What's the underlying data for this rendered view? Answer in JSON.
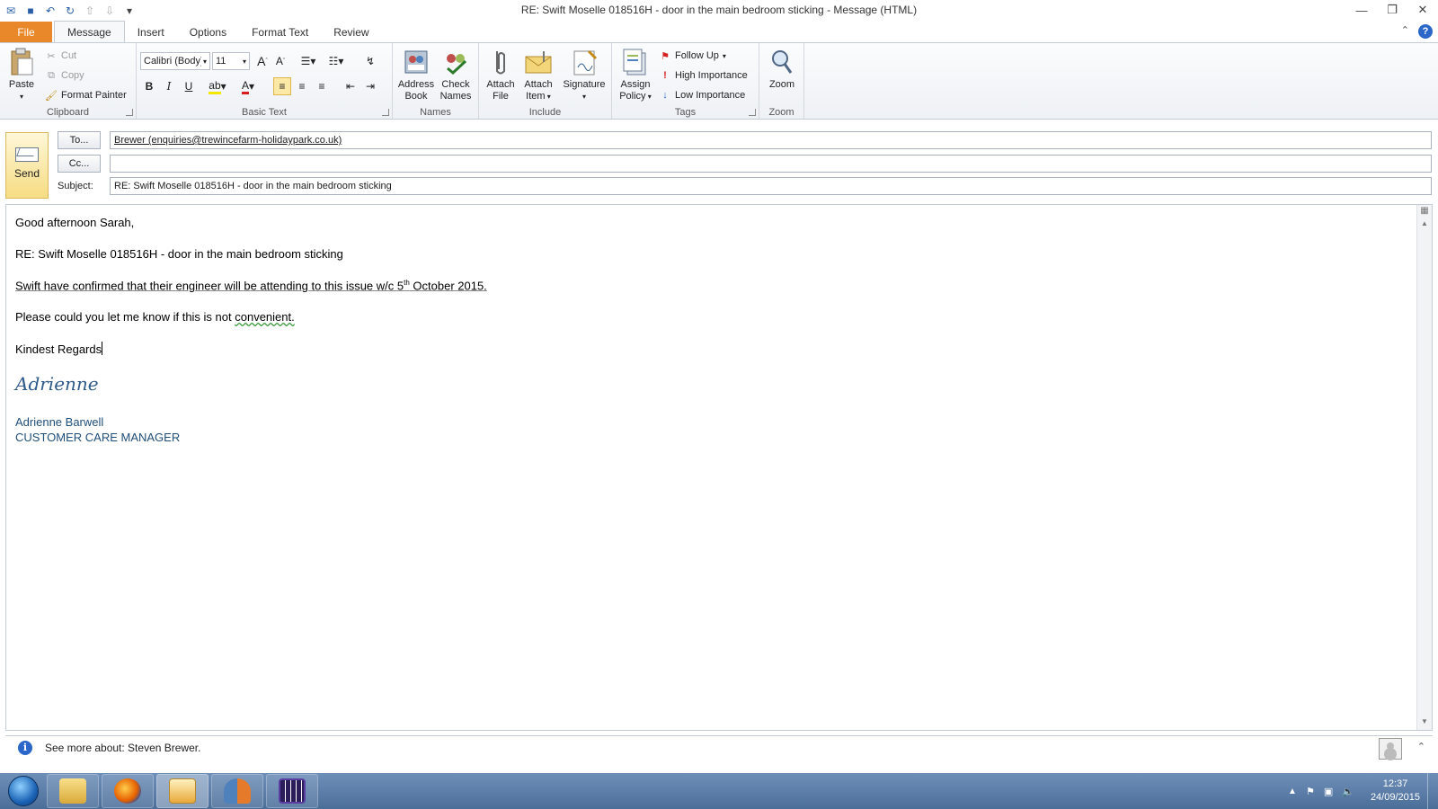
{
  "window": {
    "title": "RE: Swift Moselle 018516H - door in the main bedroom sticking  -  Message (HTML)",
    "controls": [
      "minimize",
      "restore",
      "close"
    ]
  },
  "quick_access": [
    "save-icon",
    "undo-icon",
    "redo-icon",
    "up-icon",
    "down-icon",
    "customize-icon"
  ],
  "tabs": [
    {
      "label": "File"
    },
    {
      "label": "Message"
    },
    {
      "label": "Insert"
    },
    {
      "label": "Options"
    },
    {
      "label": "Format Text"
    },
    {
      "label": "Review"
    }
  ],
  "ribbon": {
    "clipboard": {
      "label": "Clipboard",
      "paste": "Paste",
      "cut": "Cut",
      "copy": "Copy",
      "format_painter": "Format Painter"
    },
    "basic_text": {
      "label": "Basic Text",
      "font": "Calibri (Body)",
      "size": "11"
    },
    "names": {
      "label": "Names",
      "address_book_1": "Address",
      "address_book_2": "Book",
      "check_names_1": "Check",
      "check_names_2": "Names"
    },
    "include": {
      "label": "Include",
      "attach_file_1": "Attach",
      "attach_file_2": "File",
      "attach_item_1": "Attach",
      "attach_item_2": "Item",
      "signature": "Signature"
    },
    "tags": {
      "label": "Tags",
      "assign_policy_1": "Assign",
      "assign_policy_2": "Policy",
      "follow_up": "Follow Up",
      "high_importance": "High Importance",
      "low_importance": "Low Importance"
    },
    "zoom": {
      "label": "Zoom",
      "zoom": "Zoom"
    }
  },
  "header": {
    "send": "Send",
    "to_button": "To...",
    "cc_button": "Cc...",
    "subject_label": "Subject:",
    "to_value": "Brewer (enquiries@trewincefarm-holidaypark.co.uk)",
    "cc_value": "",
    "subject_value": "RE: Swift Moselle 018516H - door in the main bedroom sticking"
  },
  "body": {
    "greeting": "Good afternoon Sarah,",
    "re_line": "RE: Swift Moselle 018516H - door in the main bedroom sticking",
    "confirm_pre": "Swift have confirmed that their engineer will be attending to this issue w/c 5",
    "confirm_sup": "th",
    "confirm_post": " October 2015.",
    "request_pre": "Please could you let me know if this is not ",
    "request_word": "convenient.",
    "closing": "Kindest Regards",
    "signature_script": "Adrienne",
    "signature_name": "Adrienne Barwell",
    "signature_title": "CUSTOMER CARE MANAGER"
  },
  "people_pane": {
    "text": "See more about: Steven Brewer."
  },
  "taskbar": {
    "apps": [
      "explorer",
      "firefox",
      "outlook",
      "contacts",
      "calendar-app"
    ],
    "time": "12:37",
    "date": "24/09/2015"
  },
  "colors": {
    "file_tab": "#e9882a",
    "signature": "#1f4e79",
    "taskbar": "#5a7ca8",
    "send_button": "#f6dc83"
  }
}
